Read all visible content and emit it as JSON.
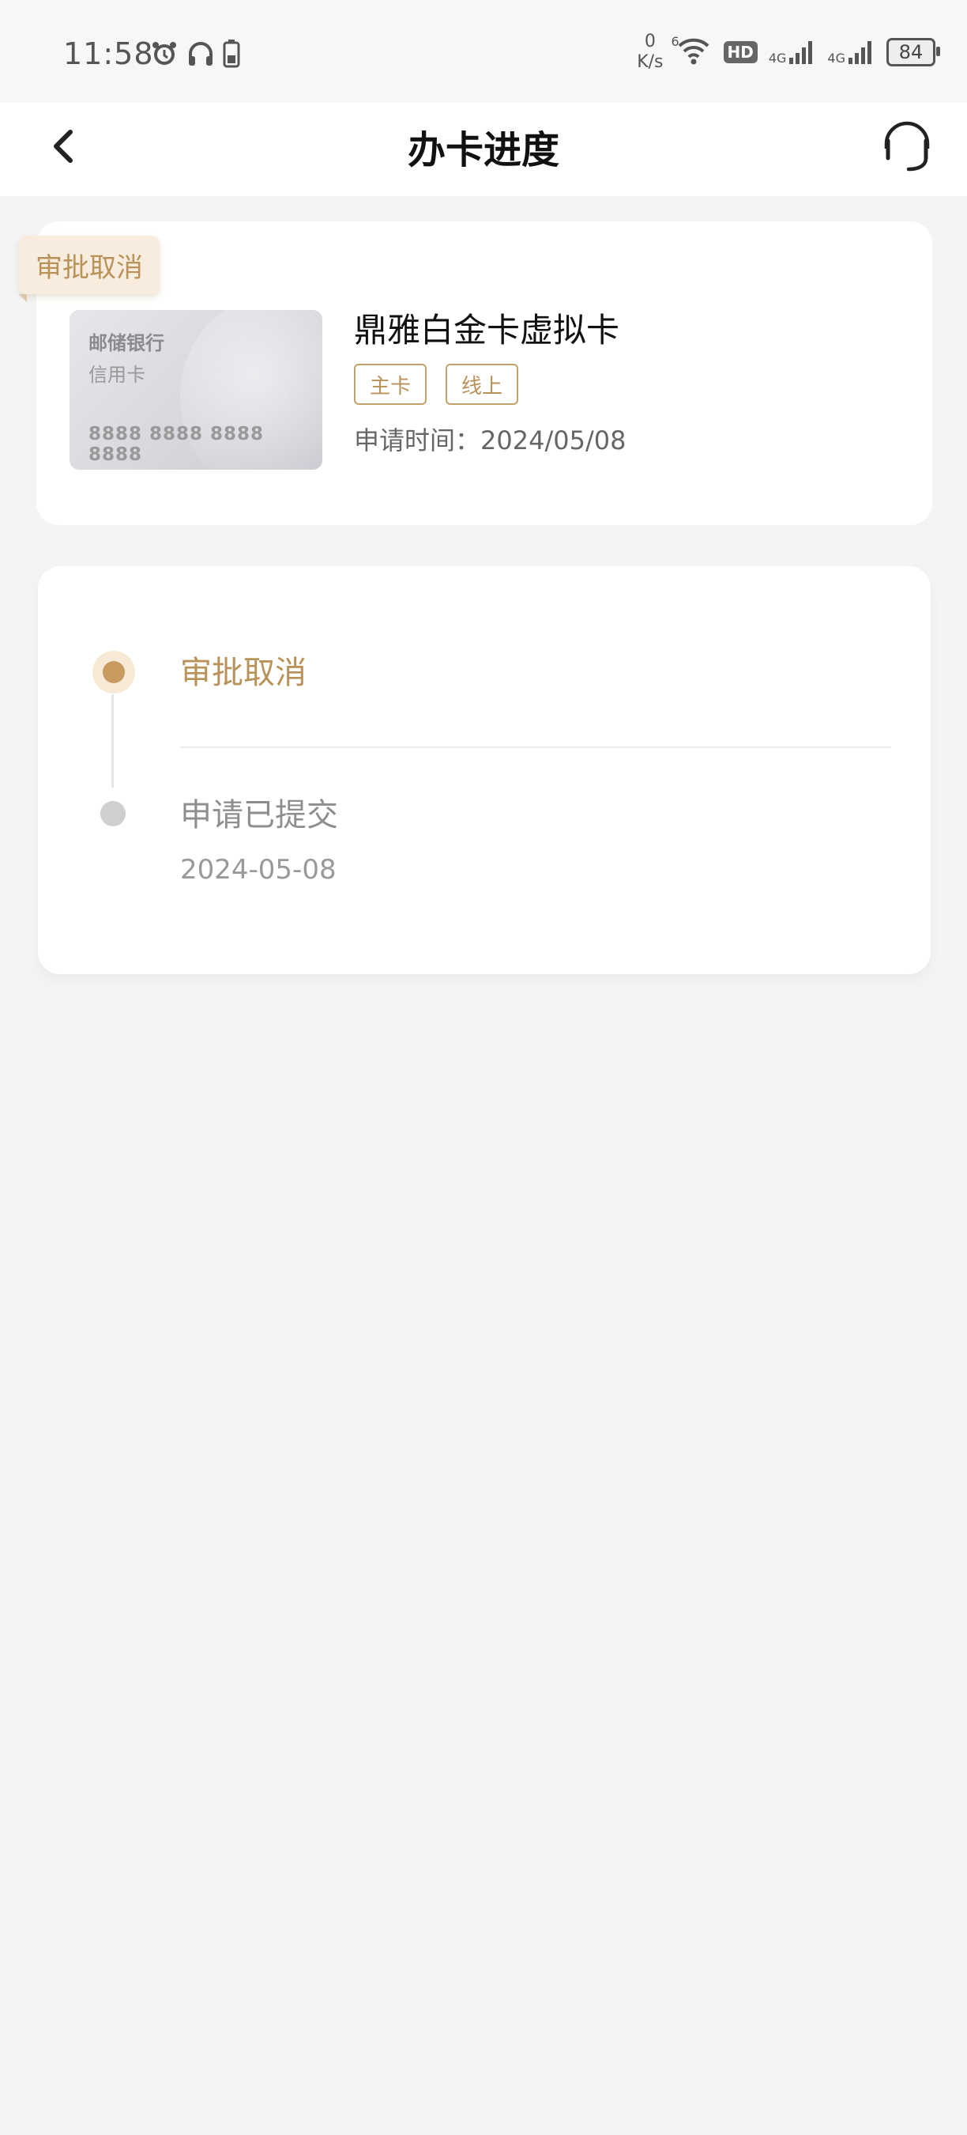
{
  "status_bar": {
    "time": "11:58",
    "net_speed_value": "0",
    "net_speed_unit": "K/s",
    "wifi_label": "6",
    "hd_label": "HD",
    "sim1_label": "4G",
    "sim2_label": "4G",
    "battery": "84"
  },
  "header": {
    "title": "办卡进度"
  },
  "card": {
    "status_tag": "审批取消",
    "thumb_bank": "邮储银行",
    "thumb_kind": "信用卡",
    "thumb_number": "8888 8888 8888 8888",
    "name": "鼎雅白金卡虚拟卡",
    "badges": [
      "主卡",
      "线上"
    ],
    "apply_date": "申请时间：2024/05/08"
  },
  "progress": {
    "steps": [
      {
        "title": "审批取消",
        "date": "",
        "active": true
      },
      {
        "title": "申请已提交",
        "date": "2024-05-08",
        "active": false
      }
    ]
  },
  "colors": {
    "accent": "#c89a5d",
    "accent_text": "#b9925a",
    "tag_bg": "#f7ecdd",
    "page_bg": "#f4f4f4"
  }
}
